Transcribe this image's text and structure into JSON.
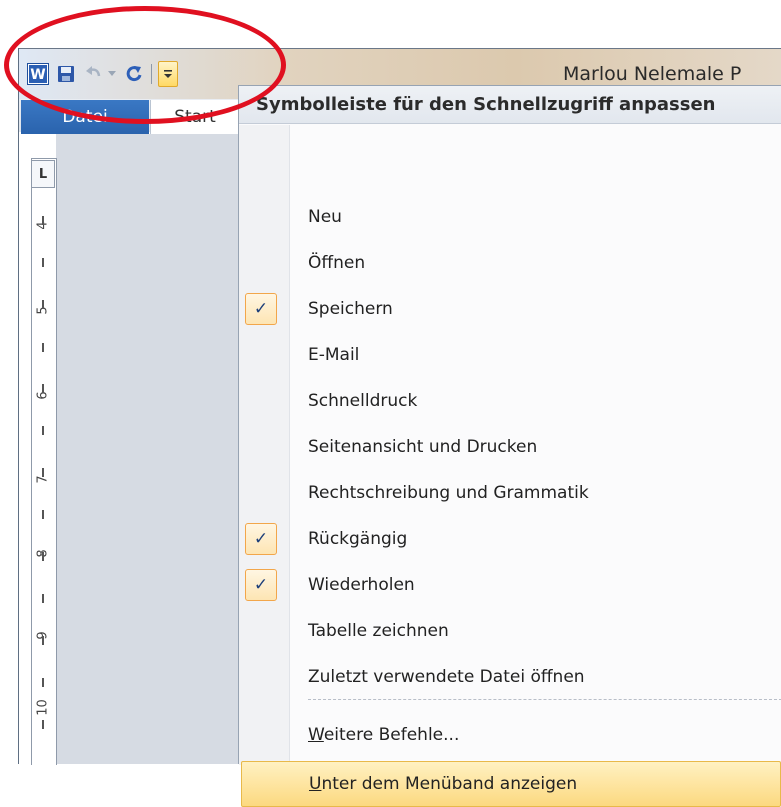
{
  "window": {
    "title": "Marlou Nelemale P"
  },
  "qat": {
    "app_icon": "word-icon",
    "save_icon": "save-icon",
    "undo_icon": "undo-icon",
    "redo_icon": "redo-icon",
    "customize_icon": "customize-qat-icon"
  },
  "ribbon": {
    "tabs": [
      {
        "label": "Datei"
      },
      {
        "label": "Start"
      }
    ]
  },
  "ruler": {
    "tab_selector": "L",
    "numbers": [
      "4",
      "5",
      "6",
      "7",
      "8",
      "9",
      "10"
    ]
  },
  "menu": {
    "header": "Symbolleiste für den Schnellzugriff anpassen",
    "items": [
      {
        "label": "Neu",
        "checked": false
      },
      {
        "label": "Öffnen",
        "checked": false
      },
      {
        "label": "Speichern",
        "checked": true
      },
      {
        "label": "E-Mail",
        "checked": false
      },
      {
        "label": "Schnelldruck",
        "checked": false
      },
      {
        "label": "Seitenansicht und Drucken",
        "checked": false
      },
      {
        "label": "Rechtschreibung und Grammatik",
        "checked": false
      },
      {
        "label": "Rückgängig",
        "checked": true
      },
      {
        "label": "Wiederholen",
        "checked": true
      },
      {
        "label": "Tabelle zeichnen",
        "checked": false
      },
      {
        "label": "Zuletzt verwendete Datei öffnen",
        "checked": false
      }
    ],
    "more_commands": {
      "accel": "W",
      "rest": "eitere Befehle..."
    },
    "show_below": {
      "accel": "U",
      "rest": "nter dem Menüband anzeigen"
    },
    "check_glyph": "✓"
  },
  "colors": {
    "annotation": "#e01020",
    "highlight": "#fcd980",
    "file_tab": "#2a63ad"
  }
}
